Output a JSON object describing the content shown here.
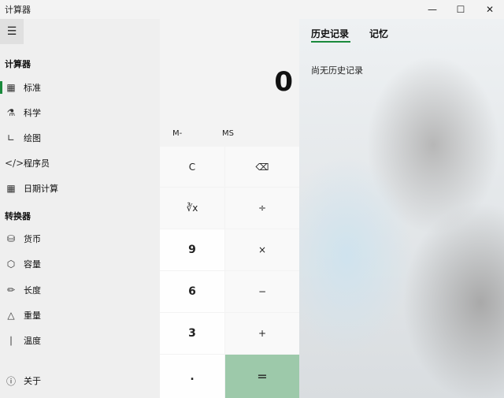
{
  "window": {
    "title": "计算器",
    "min_icon": "minimize-icon",
    "max_icon": "maximize-icon",
    "close_icon": "close-icon"
  },
  "sidebar": {
    "menu_icon": "hamburger-icon",
    "calculator_header": "计算器",
    "calculator_items": [
      {
        "label": "标准",
        "icon": "calculator-icon",
        "selected": true
      },
      {
        "label": "科学",
        "icon": "flask-icon"
      },
      {
        "label": "绘图",
        "icon": "graph-icon"
      },
      {
        "label": "程序员",
        "icon": "code-icon"
      },
      {
        "label": "日期计算",
        "icon": "calendar-icon"
      }
    ],
    "converter_header": "转换器",
    "converter_items": [
      {
        "label": "货币",
        "icon": "coins-icon"
      },
      {
        "label": "容量",
        "icon": "cube-icon"
      },
      {
        "label": "长度",
        "icon": "ruler-icon"
      },
      {
        "label": "重量",
        "icon": "weight-icon"
      },
      {
        "label": "温度",
        "icon": "thermometer-icon"
      }
    ],
    "about": {
      "label": "关于",
      "icon": "info-icon"
    }
  },
  "calculator": {
    "display": "0",
    "memory": {
      "minus": "M-",
      "store": "MS"
    },
    "buttons": {
      "clear": "C",
      "root": "∛x",
      "nine": "9",
      "six": "6",
      "three": "3",
      "decimal": ".",
      "divide": "÷",
      "multiply": "×",
      "subtract": "−",
      "add": "+",
      "equals": "="
    }
  },
  "history": {
    "tab_history": "历史记录",
    "tab_memory": "记忆",
    "empty": "尚无历史记录"
  },
  "colors": {
    "accent": "#1a8a3c",
    "equals_bg": "#9dc9aa"
  }
}
